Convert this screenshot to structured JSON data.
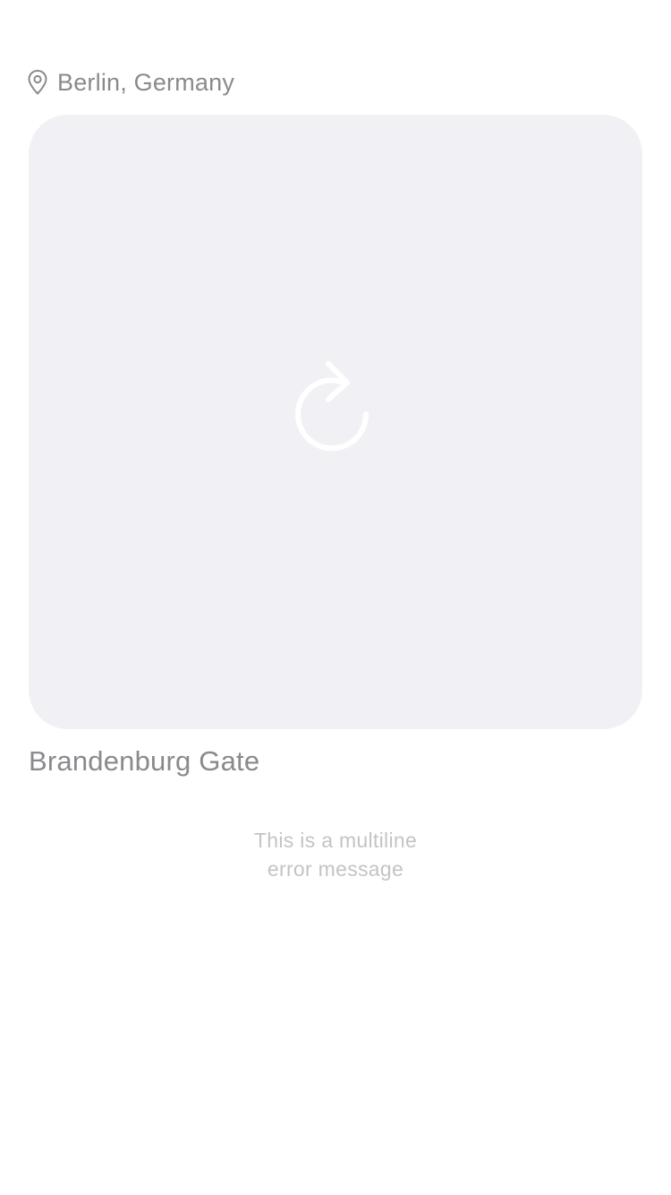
{
  "location": {
    "icon": "map-pin-icon",
    "text": "Berlin, Germany"
  },
  "image_card": {
    "state": "failed-to-load",
    "icon": "reload-icon",
    "background_color": "#f1f1f5",
    "icon_color": "#ffffff"
  },
  "place": {
    "title": "Brandenburg Gate"
  },
  "error": {
    "line1": "This is a multiline",
    "line2": "error message"
  },
  "colors": {
    "primary_text": "#8a8a8e",
    "secondary_text": "#c4c4c8"
  }
}
